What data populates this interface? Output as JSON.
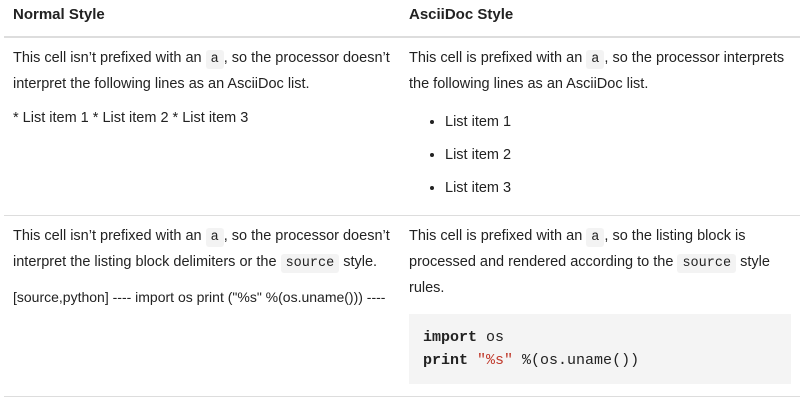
{
  "headers": {
    "normal": "Normal Style",
    "asciidoc": "AsciiDoc Style"
  },
  "row1": {
    "normal": {
      "text_pre": "This cell isn’t prefixed with an ",
      "code": "a",
      "text_post": ", so the processor doesn’t interpret the following lines as an AsciiDoc list.",
      "raw": "* List item 1 * List item 2 * List item 3"
    },
    "asciidoc": {
      "text_pre": "This cell is prefixed with an ",
      "code": "a",
      "text_post": ", so the processor interprets the following lines as an AsciiDoc list.",
      "items": [
        "List item 1",
        "List item 2",
        "List item 3"
      ]
    }
  },
  "row2": {
    "normal": {
      "text_pre": "This cell isn’t prefixed with an ",
      "code": "a",
      "text_mid": ", so the processor doesn’t interpret the listing block delimiters or the ",
      "code2": "source",
      "text_post": " style.",
      "raw": "[source,python] ---- import os print (\"%s\" %(os.uname())) ----"
    },
    "asciidoc": {
      "text_pre": "This cell is prefixed with an ",
      "code": "a",
      "text_mid": ", so the listing block is processed and rendered according to the ",
      "code2": "source",
      "text_post": " style rules.",
      "listing": {
        "line1_kw": "import",
        "line1_rest": " os",
        "line2_kw": "print",
        "line2_sp": " ",
        "line2_str": "\"%s\"",
        "line2_rest": " %(os.uname())"
      }
    }
  }
}
